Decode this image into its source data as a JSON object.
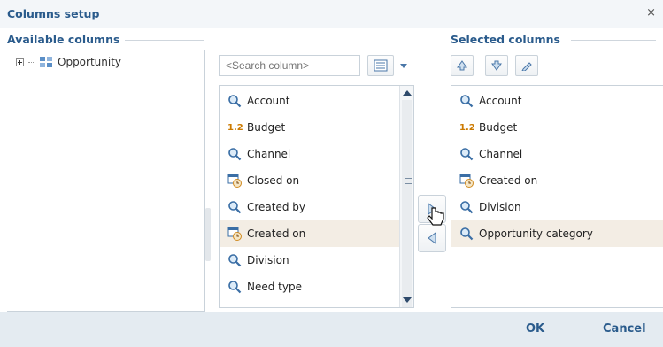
{
  "dialog": {
    "title": "Columns setup",
    "close_glyph": "×"
  },
  "available": {
    "header": "Available columns",
    "tree": [
      {
        "label": "Opportunity",
        "icon": "object-grid-icon"
      }
    ]
  },
  "search": {
    "placeholder": "<Search column>",
    "value": "<Search column>"
  },
  "column_list": [
    {
      "label": "Account",
      "icon": "lookup-icon"
    },
    {
      "label": "Budget",
      "icon": "number-icon",
      "glyph": "1.2"
    },
    {
      "label": "Channel",
      "icon": "lookup-icon"
    },
    {
      "label": "Closed on",
      "icon": "datetime-icon"
    },
    {
      "label": "Created by",
      "icon": "lookup-icon"
    },
    {
      "label": "Created on",
      "icon": "datetime-icon",
      "selected": true
    },
    {
      "label": "Division",
      "icon": "lookup-icon"
    },
    {
      "label": "Need type",
      "icon": "lookup-icon"
    }
  ],
  "selected": {
    "header": "Selected columns",
    "items": [
      {
        "label": "Account",
        "icon": "lookup-icon"
      },
      {
        "label": "Budget",
        "icon": "number-icon",
        "glyph": "1.2"
      },
      {
        "label": "Channel",
        "icon": "lookup-icon"
      },
      {
        "label": "Created on",
        "icon": "datetime-icon"
      },
      {
        "label": "Division",
        "icon": "lookup-icon"
      },
      {
        "label": "Opportunity category",
        "icon": "lookup-icon",
        "selected": true
      }
    ]
  },
  "footer": {
    "ok_label": "OK",
    "cancel_label": "Cancel"
  },
  "colors": {
    "accent": "#2a5b8c",
    "selection": "#f3ede4",
    "footer_bg": "#e4ebf1"
  }
}
